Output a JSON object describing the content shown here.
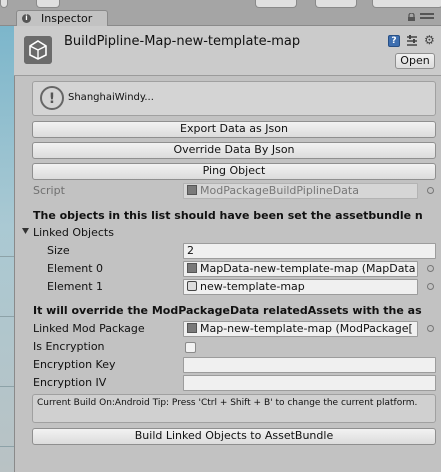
{
  "tab": {
    "label": "Inspector",
    "icon": "info-icon"
  },
  "header": {
    "title": "BuildPipline-Map-new-template-map",
    "open_label": "Open",
    "icons": [
      "unity-logo-icon",
      "help-icon",
      "preset-icon",
      "gear-icon"
    ]
  },
  "helpbox": {
    "text": "ShanghaiWindy...",
    "icon": "warning-icon"
  },
  "buttons": {
    "export": "Export Data as Json",
    "override": "Override Data By Json",
    "ping": "Ping Object",
    "build": "Build Linked Objects to AssetBundle"
  },
  "script": {
    "label": "Script",
    "value": "ModPackageBuildPiplineData"
  },
  "notice1": "The objects in this list should have been set the assetbundle n",
  "linked_objects": {
    "label": "Linked Objects",
    "size_label": "Size",
    "size_value": "2",
    "elements": [
      {
        "label": "Element 0",
        "value": "MapData-new-template-map (MapData"
      },
      {
        "label": "Element 1",
        "value": "new-template-map"
      }
    ]
  },
  "notice2": "It will override the ModPackageData relatedAssets with the as",
  "fields": {
    "linked_mod_label": "Linked Mod Package",
    "linked_mod_value": "Map-new-template-map (ModPackage[",
    "encryption_label": "Is Encryption",
    "encryption_checked": false,
    "key_label": "Encryption Key",
    "key_value": "",
    "iv_label": "Encryption IV",
    "iv_value": ""
  },
  "status": "Current Build On:Android  Tip: Press 'Ctrl + Shift + B' to change the current platform.",
  "colors": {
    "panel": "#c2c2c2",
    "accent": "#3e6fb0"
  }
}
